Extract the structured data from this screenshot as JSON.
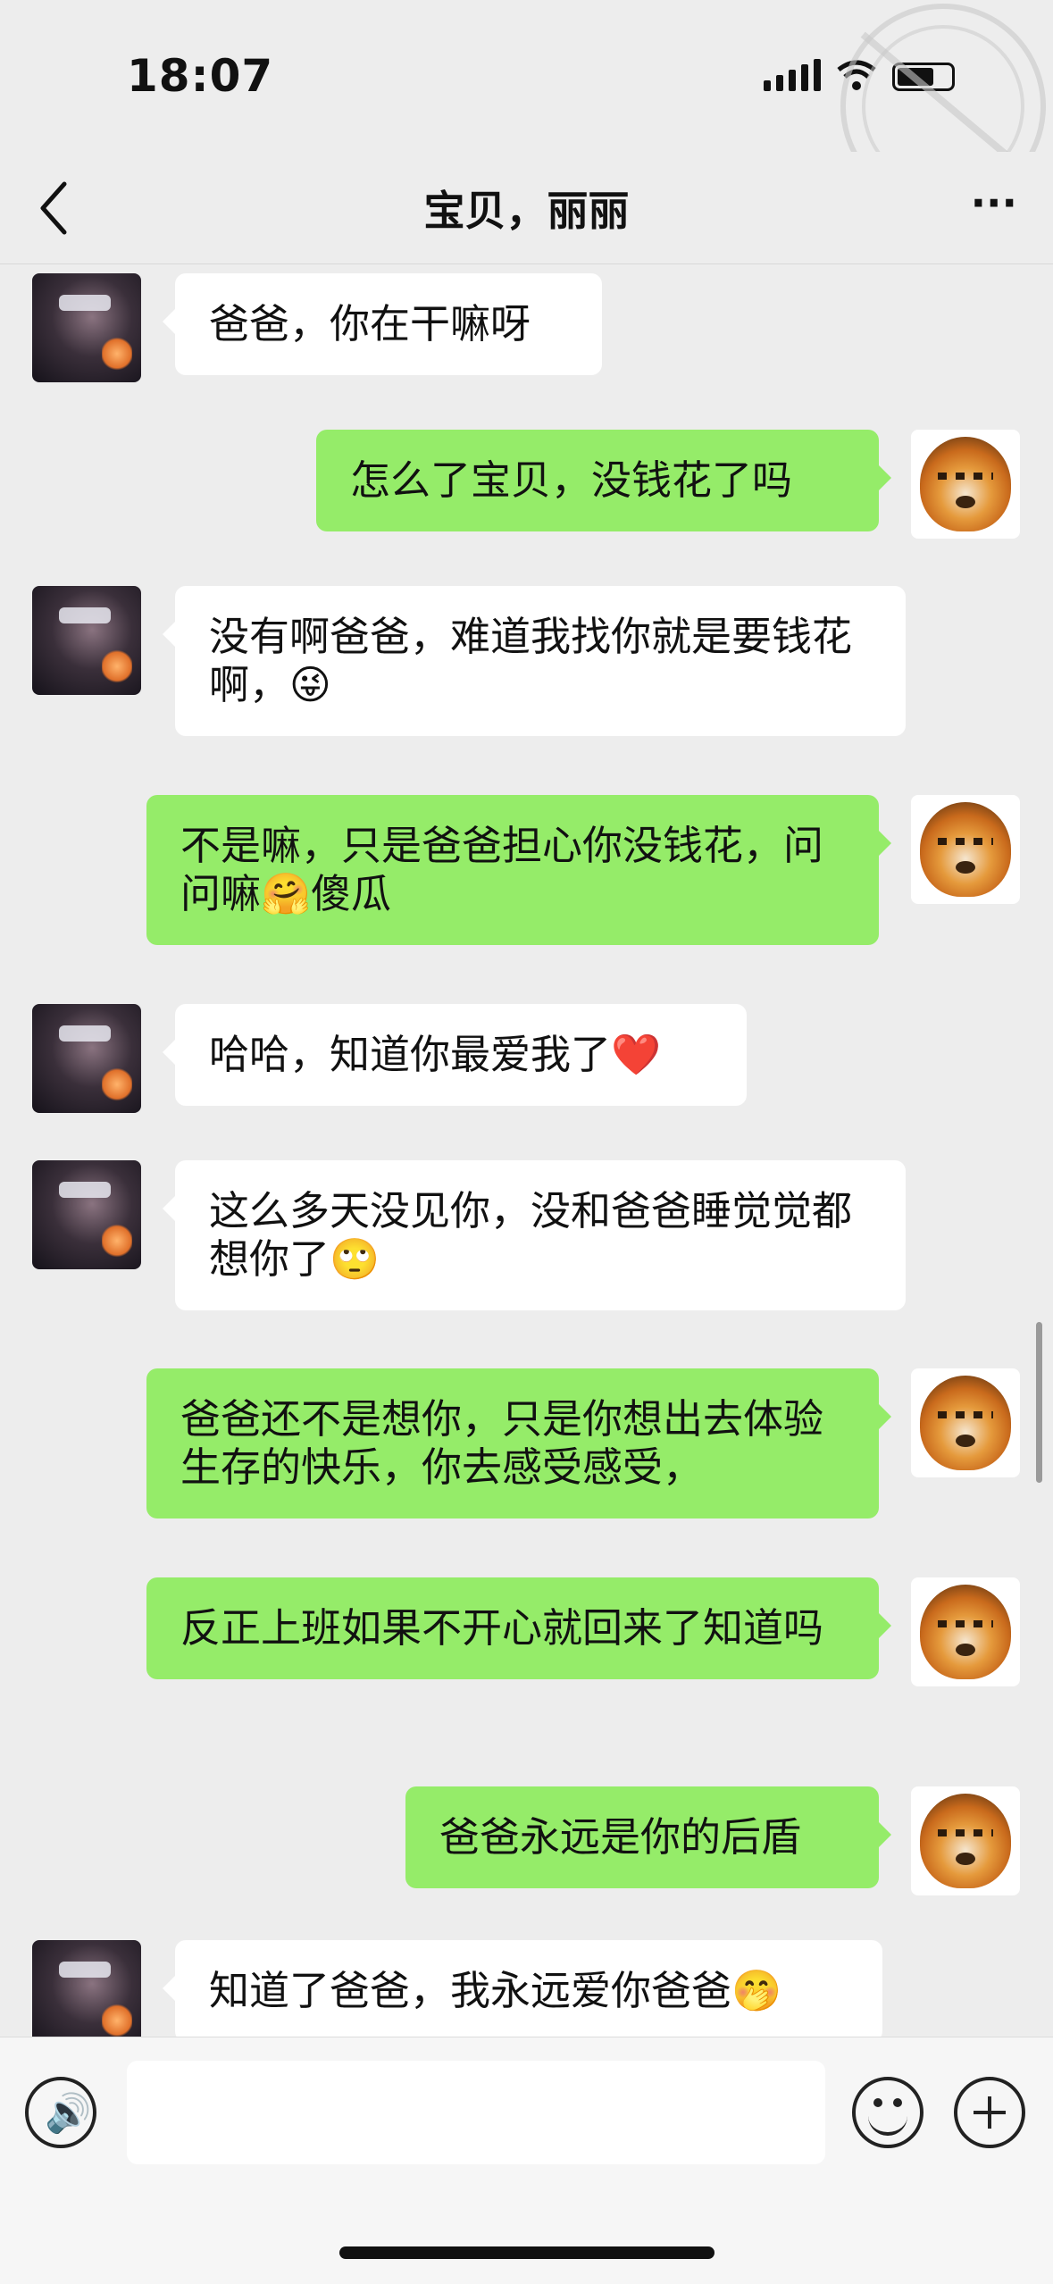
{
  "status_bar": {
    "time": "18:07"
  },
  "nav": {
    "title": "宝贝，丽丽",
    "back_icon": "chevron-left-icon",
    "more_icon": "more-icon",
    "more_label": "···"
  },
  "messages": [
    {
      "side": "in",
      "text": "爸爸，你在干嘛呀"
    },
    {
      "side": "out",
      "text": "怎么了宝贝，没钱花了吗"
    },
    {
      "side": "in",
      "text": "没有啊爸爸，难道我找你就是要钱花啊，😜"
    },
    {
      "side": "out",
      "text": "不是嘛，只是爸爸担心你没钱花，问问嘛🤗傻瓜"
    },
    {
      "side": "in",
      "text": "哈哈，知道你最爱我了❤️"
    },
    {
      "side": "in",
      "text": "这么多天没见你，没和爸爸睡觉觉都想你了🙄"
    },
    {
      "side": "out",
      "text": "爸爸还不是想你，只是你想出去体验生存的快乐，你去感受感受，"
    },
    {
      "side": "out",
      "text": "反正上班如果不开心就回来了知道吗"
    },
    {
      "side": "out",
      "text": "爸爸永远是你的后盾"
    },
    {
      "side": "in",
      "text": "知道了爸爸，我永远爱你爸爸🤭"
    }
  ],
  "input_bar": {
    "voice_icon": "voice-icon",
    "voice_glyph": "🔊",
    "text_value": "",
    "emoji_icon": "emoji-icon",
    "plus_icon": "plus-icon"
  },
  "colors": {
    "background": "#ededed",
    "outgoing_bubble": "#95ec69",
    "incoming_bubble": "#ffffff"
  }
}
